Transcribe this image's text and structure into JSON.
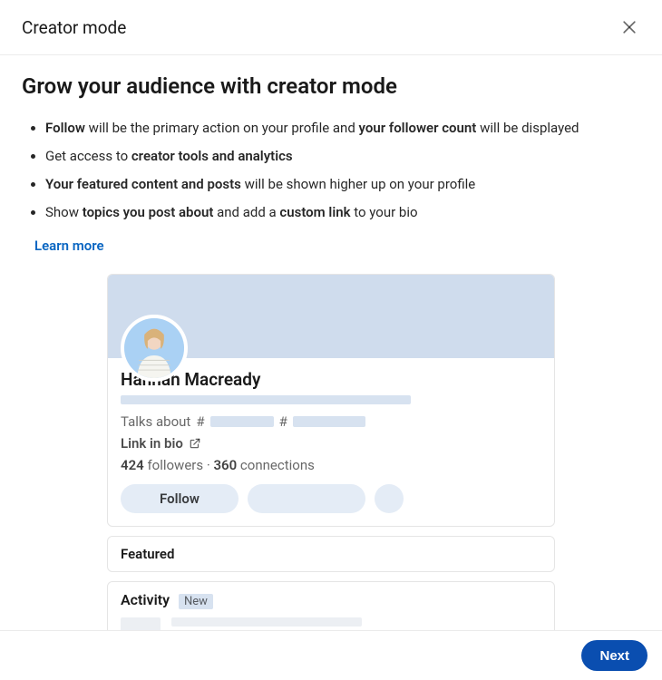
{
  "modal": {
    "title": "Creator mode",
    "headline": "Grow your audience with creator mode",
    "bullets": [
      {
        "pre": "",
        "bold1": "Follow",
        "mid1": " will be the primary action on your profile and ",
        "bold2": "your follower count",
        "post": " will be displayed"
      },
      {
        "pre": "Get access to ",
        "bold1": "creator tools and analytics",
        "mid1": "",
        "bold2": "",
        "post": ""
      },
      {
        "pre": "",
        "bold1": "Your featured content and posts",
        "mid1": " will be shown higher up on your profile",
        "bold2": "",
        "post": ""
      },
      {
        "pre": "Show ",
        "bold1": "topics you post about",
        "mid1": " and add a ",
        "bold2": "custom link",
        "post": " to your bio"
      }
    ],
    "learn_more": "Learn more",
    "next": "Next"
  },
  "preview": {
    "name": "Hannah Macready",
    "talks_about": "Talks about",
    "hash": "#",
    "link_in_bio": "Link in bio",
    "followers_count": "424",
    "followers_label": " followers",
    "sep": " · ",
    "connections_count": "360",
    "connections_label": " connections",
    "follow_label": "Follow",
    "featured_title": "Featured",
    "activity_title": "Activity",
    "badge_new": "New"
  }
}
